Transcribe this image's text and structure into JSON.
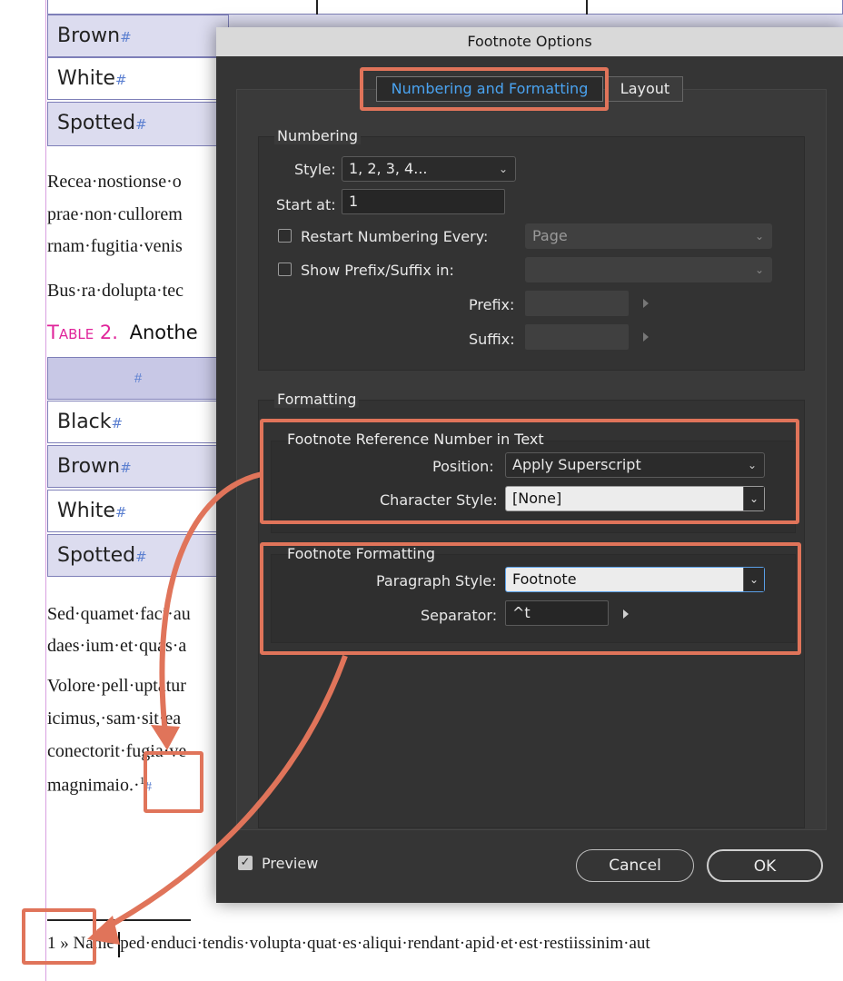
{
  "document": {
    "top_table_rows": [
      "Brown",
      "White",
      "Spotted"
    ],
    "pilcrow": "#",
    "para1_lines": [
      "Recea·nostionse·o",
      "prae·non·cullorem",
      "rnam·fugitia·venis"
    ],
    "para2": "Bus·ra·dolupta·tec",
    "table_caption_label": "Table 2.",
    "table_caption_text": "Anothe",
    "table2_header": "#",
    "table2_rows": [
      "Black",
      "Brown",
      "White",
      "Spotted"
    ],
    "para3_lines": [
      "Sed·quamet·faci·au",
      "daes·ium·et·quas·a"
    ],
    "para4_lines": [
      "Volore·pell·uptatur",
      "icimus,·sam·sit·ea",
      "conectorit·fugia·ve",
      "magnimaio.·"
    ],
    "footnote_ref": "1",
    "footnote_line": "1 » Name·ped·enduci·tendis·volupta·quat·es·aliqui·rendant·apid·et·est·restiissinim·aut"
  },
  "dialog": {
    "title": "Footnote Options",
    "tabs": [
      {
        "label": "Numbering and Formatting",
        "selected": true
      },
      {
        "label": "Layout",
        "selected": false
      }
    ],
    "numbering": {
      "section_label": "Numbering",
      "style_label": "Style:",
      "style_value": "1, 2, 3, 4...",
      "start_at_label": "Start at:",
      "start_at_value": "1",
      "restart_label": "Restart Numbering Every:",
      "restart_checked": false,
      "restart_value": "Page",
      "prefix_suffix_label": "Show Prefix/Suffix in:",
      "prefix_suffix_checked": false,
      "prefix_suffix_value": "",
      "prefix_label": "Prefix:",
      "prefix_value": "",
      "suffix_label": "Suffix:",
      "suffix_value": ""
    },
    "formatting": {
      "section_label": "Formatting",
      "ref_group_label": "Footnote Reference Number in Text",
      "position_label": "Position:",
      "position_value": "Apply Superscript",
      "char_style_label": "Character Style:",
      "char_style_value": "[None]",
      "fn_group_label": "Footnote Formatting",
      "para_style_label": "Paragraph Style:",
      "para_style_value": "Footnote",
      "separator_label": "Separator:",
      "separator_value": "^t"
    },
    "preview_label": "Preview",
    "preview_checked": true,
    "cancel_label": "Cancel",
    "ok_label": "OK"
  },
  "colors": {
    "highlight": "#e0745a",
    "accent_blue": "#4aa3f0",
    "caption_magenta": "#e0249a",
    "table_shade": "#dcdcef"
  }
}
